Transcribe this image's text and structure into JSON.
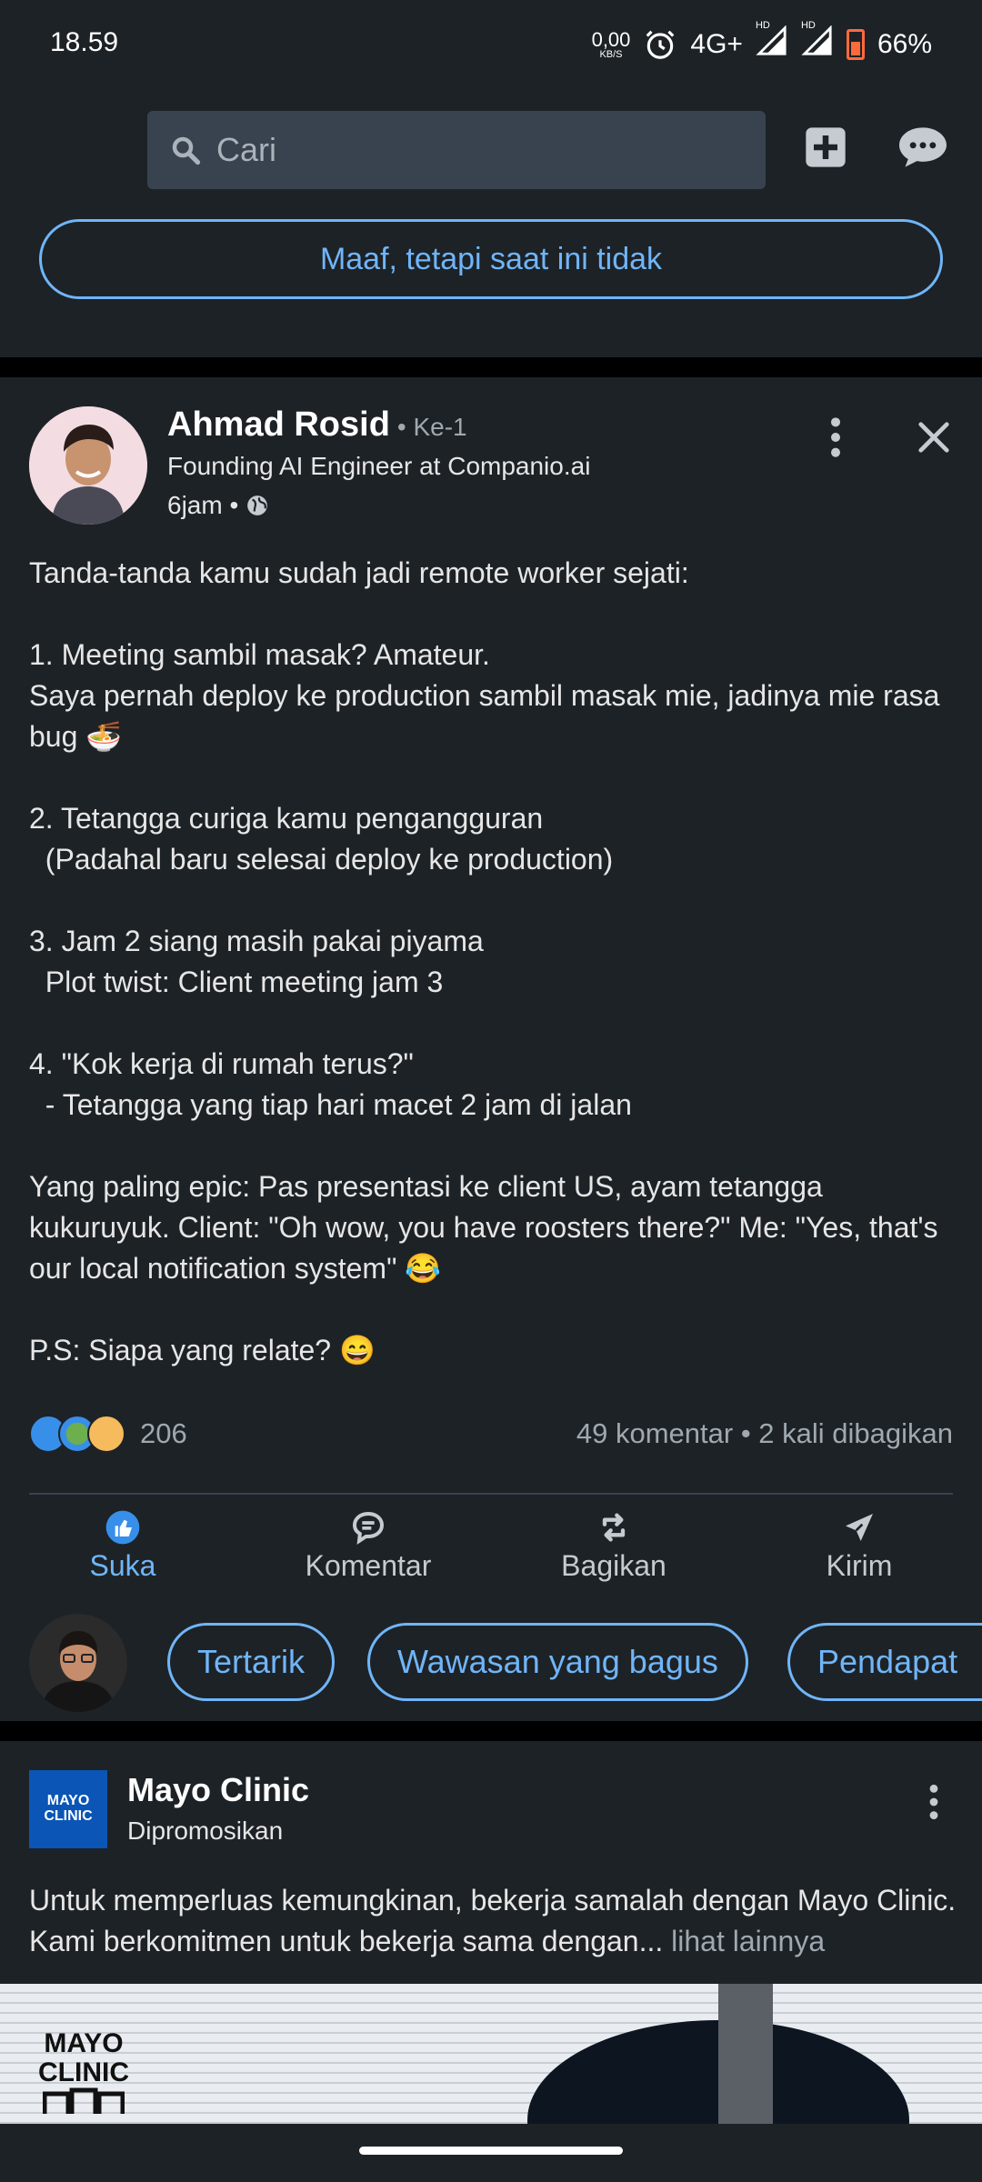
{
  "status_bar": {
    "time": "18.59",
    "net_speed": "0,00",
    "net_unit": "KB/S",
    "network": "4G+",
    "hd1": "HD",
    "hd2": "HD",
    "battery": "66%"
  },
  "top_bar": {
    "search_placeholder": "Cari",
    "icons": [
      "search-icon",
      "add-post-icon",
      "messaging-icon"
    ]
  },
  "dismiss_button": {
    "label": "Maaf, tetapi saat ini tidak"
  },
  "post": {
    "author": "Ahmad Rosid",
    "degree": "• Ke-1",
    "headline": "Founding AI Engineer at Companio.ai",
    "time": "6jam •",
    "text": [
      "Tanda-tanda kamu sudah jadi remote worker sejati:",
      "",
      "1. Meeting sambil masak? Amateur.",
      "Saya pernah deploy ke production sambil masak mie, jadinya mie rasa bug 🍜",
      "",
      "2. Tetangga curiga kamu pengangguran",
      "  (Padahal baru selesai deploy ke production)",
      "",
      "3. Jam 2 siang masih pakai piyama",
      "  Plot twist: Client meeting jam 3",
      "",
      "4. \"Kok kerja di rumah terus?\"",
      "  - Tetangga yang tiap hari macet 2 jam di jalan",
      "",
      "Yang paling epic: Pas presentasi ke client US, ayam tetangga kukuruyuk. Client: \"Oh wow, you have roosters there?\" Me: \"Yes, that's our local notification system\" 😂",
      "",
      "P.S: Siapa yang relate? 😄"
    ],
    "reaction_count": "206",
    "comments_shares": "49 komentar • 2 kali dibagikan",
    "actions": [
      {
        "label": "Suka",
        "icon": "like-icon",
        "active": true
      },
      {
        "label": "Komentar",
        "icon": "comment-icon",
        "active": false
      },
      {
        "label": "Bagikan",
        "icon": "repost-icon",
        "active": false
      },
      {
        "label": "Kirim",
        "icon": "send-icon",
        "active": false
      }
    ],
    "quick_replies": [
      "Tertarik",
      "Wawasan yang bagus",
      "Pendapat"
    ]
  },
  "ad": {
    "logo_line1": "MAYO",
    "logo_line2": "CLINIC",
    "name": "Mayo Clinic",
    "sub": "Dipromosikan",
    "text": "Untuk memperluas kemungkinan, bekerja samalah dengan Mayo Clinic. Kami berkomitmen untuk bekerja sama dengan...",
    "more": " lihat lainnya",
    "image_logo_line1": "MAYO",
    "image_logo_line2": "CLINIC"
  },
  "colors": {
    "background": "#1d2226",
    "accent": "#70b5f9",
    "search_bg": "#38434f"
  }
}
